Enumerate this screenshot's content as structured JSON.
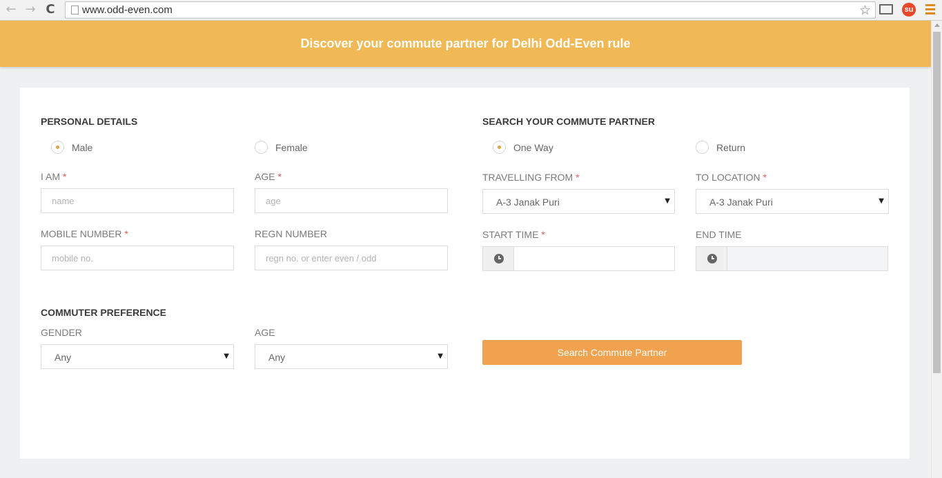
{
  "browser": {
    "url": "www.odd-even.com",
    "back_icon": "←",
    "forward_icon": "→",
    "reload_icon": "C",
    "star_icon": "☆",
    "extension_badge": "su"
  },
  "banner": {
    "title": "Discover your commute partner for Delhi Odd-Even rule"
  },
  "personal_details": {
    "title": "PERSONAL DETAILS",
    "gender_options": [
      "Male",
      "Female"
    ],
    "selected_gender": "Male",
    "i_am_label": "I AM",
    "i_am_placeholder": "name",
    "age_label": "AGE",
    "age_placeholder": "age",
    "mobile_label": "MOBILE NUMBER",
    "mobile_placeholder": "mobile no.",
    "regn_label": "REGN NUMBER",
    "regn_placeholder": "regn no. or enter even / odd",
    "required_mark": "*"
  },
  "commuter_preference": {
    "title": "COMMUTER PREFERENCE",
    "gender_label": "GENDER",
    "gender_value": "Any",
    "age_label": "AGE",
    "age_value": "Any"
  },
  "search": {
    "title": "SEARCH YOUR COMMUTE PARTNER",
    "trip_options": [
      "One Way",
      "Return"
    ],
    "selected_trip": "One Way",
    "from_label": "TRAVELLING FROM",
    "from_value": "A-3 Janak Puri",
    "to_label": "TO LOCATION",
    "to_value": "A-3 Janak Puri",
    "start_label": "START TIME",
    "end_label": "END TIME",
    "button_label": "Search Commute Partner"
  },
  "colors": {
    "banner": "#f0b955",
    "button": "#f0a24e",
    "radio_accent": "#e6a23c",
    "required": "#e05a5a"
  }
}
